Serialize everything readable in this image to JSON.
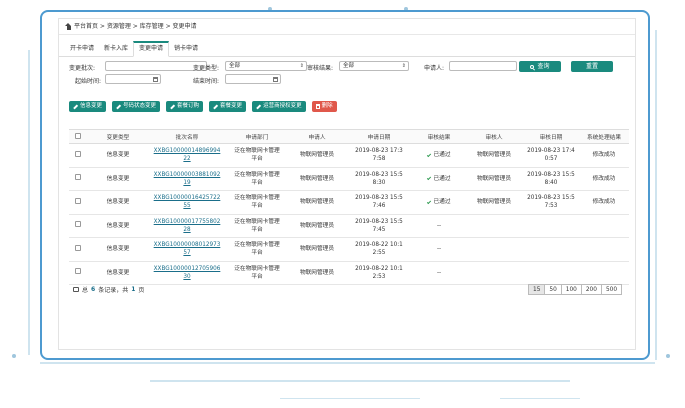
{
  "breadcrumb": {
    "text": "平台首页 > 资源管理 > 库存管理 > 变更申请"
  },
  "tabs": [
    {
      "label": "开卡申请"
    },
    {
      "label": "新卡入库"
    },
    {
      "label": "变更申请"
    },
    {
      "label": "销卡申请"
    }
  ],
  "filters": {
    "batch_no_label": "变更批次:",
    "change_type_label": "变更类型:",
    "change_type_value": "全部",
    "audit_result_label": "审核结果:",
    "audit_result_value": "全部",
    "applicant_label": "申请人:",
    "start_time_label": "起始时间:",
    "end_time_label": "结束时间:",
    "search_label": "查询",
    "reset_label": "重置"
  },
  "toolbar": {
    "info_change": "信息变更",
    "number_status_change": "号码状态变更",
    "package_order": "套餐订购",
    "package_change": "套餐变更",
    "operator_auth_change": "运营商授权变更",
    "delete": "删除"
  },
  "table": {
    "headers": [
      "变更类型",
      "批次名称",
      "申请部门",
      "申请人",
      "申请日期",
      "审核结果",
      "审核人",
      "审核日期",
      "系统处理结果"
    ],
    "rows": [
      {
        "type": "信息变更",
        "batch1": "XXBG10000014896994",
        "batch2": "22",
        "dept1": "泛在物联网卡管理",
        "dept2": "平台",
        "applicant": "物联网管理员",
        "date1": "2019-08-23 17:3",
        "date2": "7:58",
        "result": "已通过",
        "auditor": "物联网管理员",
        "adate1": "2019-08-23 17:4",
        "adate2": "0:57",
        "sys": "修改成功"
      },
      {
        "type": "信息变更",
        "batch1": "XXBG10000003881092",
        "batch2": "19",
        "dept1": "泛在物联网卡管理",
        "dept2": "平台",
        "applicant": "物联网管理员",
        "date1": "2019-08-23 15:5",
        "date2": "8:30",
        "result": "已通过",
        "auditor": "物联网管理员",
        "adate1": "2019-08-23 15:5",
        "adate2": "8:40",
        "sys": "修改成功"
      },
      {
        "type": "信息变更",
        "batch1": "XXBG10000016425722",
        "batch2": "55",
        "dept1": "泛在物联网卡管理",
        "dept2": "平台",
        "applicant": "物联网管理员",
        "date1": "2019-08-23 15:5",
        "date2": "7:46",
        "result": "已通过",
        "auditor": "物联网管理员",
        "adate1": "2019-08-23 15:5",
        "adate2": "7:53",
        "sys": "修改成功"
      },
      {
        "type": "信息变更",
        "batch1": "XXBG10000017755802",
        "batch2": "28",
        "dept1": "泛在物联网卡管理",
        "dept2": "平台",
        "applicant": "物联网管理员",
        "date1": "2019-08-23 15:5",
        "date2": "7:45",
        "result": "--",
        "auditor": "",
        "adate1": "",
        "adate2": "",
        "sys": ""
      },
      {
        "type": "信息变更",
        "batch1": "XXBG10000008012973",
        "batch2": "57",
        "dept1": "泛在物联网卡管理",
        "dept2": "平台",
        "applicant": "物联网管理员",
        "date1": "2019-08-22 10:1",
        "date2": "2:55",
        "result": "--",
        "auditor": "",
        "adate1": "",
        "adate2": "",
        "sys": ""
      },
      {
        "type": "信息变更",
        "batch1": "XXBG10000012705906",
        "batch2": "30",
        "dept1": "泛在物联网卡管理",
        "dept2": "平台",
        "applicant": "物联网管理员",
        "date1": "2019-08-22 10:1",
        "date2": "2:53",
        "result": "--",
        "auditor": "",
        "adate1": "",
        "adate2": "",
        "sys": ""
      }
    ]
  },
  "footer": {
    "prefix": "总",
    "count": "6",
    "middle": "条记录，共",
    "pages": "1",
    "suffix": "页"
  },
  "pager": [
    "15",
    "50",
    "100",
    "200",
    "500"
  ],
  "colors": {
    "accent": "#1a8a7e",
    "danger": "#e0584b",
    "frame": "#4d9ad0"
  }
}
